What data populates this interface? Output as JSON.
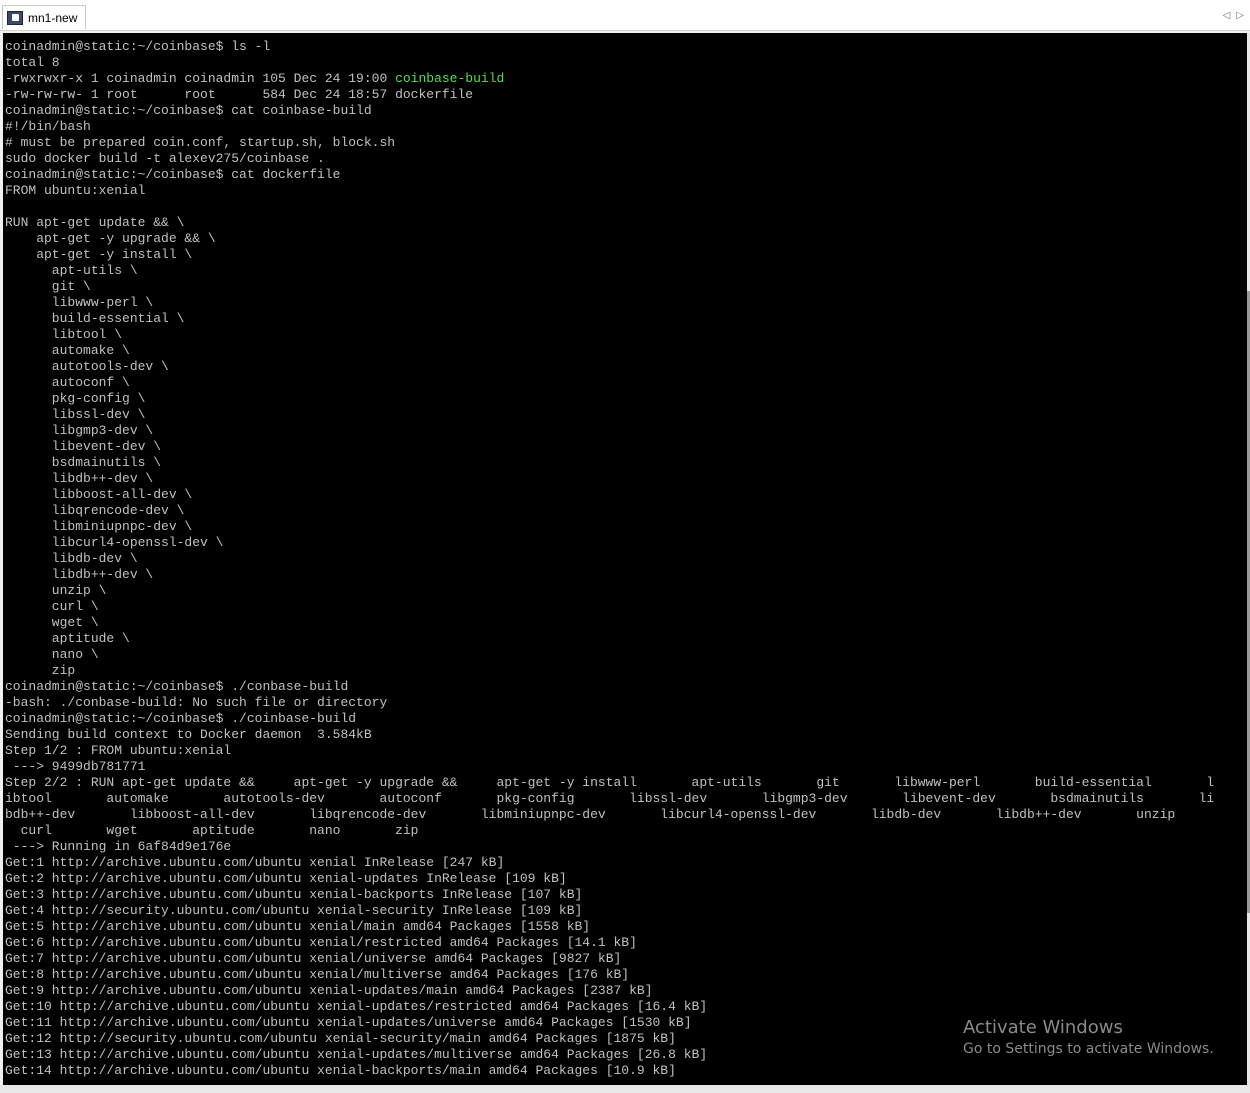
{
  "window": {
    "tab_title": "mn1-new"
  },
  "terminal": {
    "lines": [
      "coinadmin@static:~/coinbase$ ls -l",
      "total 8",
      "-rwxrwxr-x 1 coinadmin coinadmin 105 Dec 24 19:00 ",
      "-rw-rw-rw- 1 root      root      584 Dec 24 18:57 dockerfile",
      "coinadmin@static:~/coinbase$ cat coinbase-build",
      "#!/bin/bash",
      "# must be prepared coin.conf, startup.sh, block.sh",
      "sudo docker build -t alexev275/coinbase .",
      "coinadmin@static:~/coinbase$ cat dockerfile",
      "FROM ubuntu:xenial",
      "",
      "RUN apt-get update && \\",
      "    apt-get -y upgrade && \\",
      "    apt-get -y install \\",
      "      apt-utils \\",
      "      git \\",
      "      libwww-perl \\",
      "      build-essential \\",
      "      libtool \\",
      "      automake \\",
      "      autotools-dev \\",
      "      autoconf \\",
      "      pkg-config \\",
      "      libssl-dev \\",
      "      libgmp3-dev \\",
      "      libevent-dev \\",
      "      bsdmainutils \\",
      "      libdb++-dev \\",
      "      libboost-all-dev \\",
      "      libqrencode-dev \\",
      "      libminiupnpc-dev \\",
      "      libcurl4-openssl-dev \\",
      "      libdb-dev \\",
      "      libdb++-dev \\",
      "      unzip \\",
      "      curl \\",
      "      wget \\",
      "      aptitude \\",
      "      nano \\",
      "      zip",
      "coinadmin@static:~/coinbase$ ./conbase-build",
      "-bash: ./conbase-build: No such file or directory",
      "coinadmin@static:~/coinbase$ ./coinbase-build",
      "Sending build context to Docker daemon  3.584kB",
      "Step 1/2 : FROM ubuntu:xenial",
      " ---> 9499db781771",
      "Step 2/2 : RUN apt-get update &&     apt-get -y upgrade &&     apt-get -y install       apt-utils       git       libwww-perl       build-essential       l",
      "ibtool       automake       autotools-dev       autoconf       pkg-config       libssl-dev       libgmp3-dev       libevent-dev       bsdmainutils       li",
      "bdb++-dev       libboost-all-dev       libqrencode-dev       libminiupnpc-dev       libcurl4-openssl-dev       libdb-dev       libdb++-dev       unzip",
      "  curl       wget       aptitude       nano       zip",
      " ---> Running in 6af84d9e176e",
      "Get:1 http://archive.ubuntu.com/ubuntu xenial InRelease [247 kB]",
      "Get:2 http://archive.ubuntu.com/ubuntu xenial-updates InRelease [109 kB]",
      "Get:3 http://archive.ubuntu.com/ubuntu xenial-backports InRelease [107 kB]",
      "Get:4 http://security.ubuntu.com/ubuntu xenial-security InRelease [109 kB]",
      "Get:5 http://archive.ubuntu.com/ubuntu xenial/main amd64 Packages [1558 kB]",
      "Get:6 http://archive.ubuntu.com/ubuntu xenial/restricted amd64 Packages [14.1 kB]",
      "Get:7 http://archive.ubuntu.com/ubuntu xenial/universe amd64 Packages [9827 kB]",
      "Get:8 http://archive.ubuntu.com/ubuntu xenial/multiverse amd64 Packages [176 kB]",
      "Get:9 http://archive.ubuntu.com/ubuntu xenial-updates/main amd64 Packages [2387 kB]",
      "Get:10 http://archive.ubuntu.com/ubuntu xenial-updates/restricted amd64 Packages [16.4 kB]",
      "Get:11 http://archive.ubuntu.com/ubuntu xenial-updates/universe amd64 Packages [1530 kB]",
      "Get:12 http://security.ubuntu.com/ubuntu xenial-security/main amd64 Packages [1875 kB]",
      "Get:13 http://archive.ubuntu.com/ubuntu xenial-updates/multiverse amd64 Packages [26.8 kB]",
      "Get:14 http://archive.ubuntu.com/ubuntu xenial-backports/main amd64 Packages [10.9 kB]"
    ],
    "highlight": {
      "text": "coinbase-build",
      "color": "#50e050"
    }
  },
  "watermark": {
    "title": "Activate Windows",
    "subtitle": "Go to Settings to activate Windows."
  }
}
